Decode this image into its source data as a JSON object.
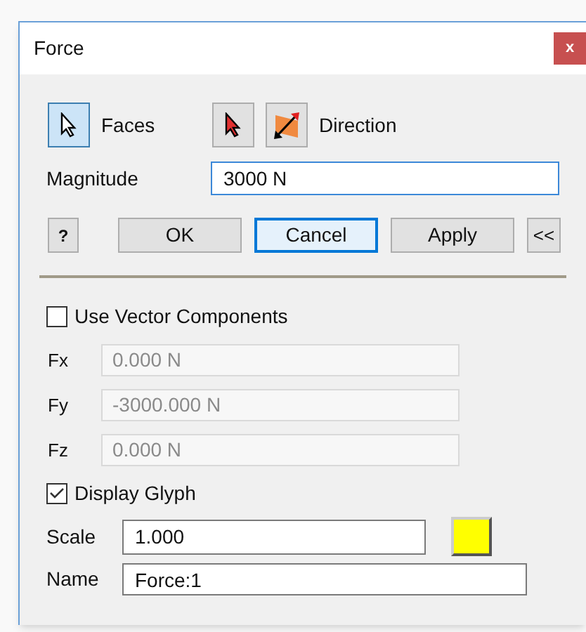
{
  "window": {
    "title": "Force",
    "close": "x"
  },
  "faces": {
    "label": "Faces",
    "selected": true
  },
  "direction": {
    "label": "Direction"
  },
  "magnitude": {
    "label": "Magnitude",
    "value": "3000 N"
  },
  "help": {
    "label": "?"
  },
  "buttons": [
    {
      "label": "OK",
      "focused": false
    },
    {
      "label": "Cancel",
      "focused": true
    },
    {
      "label": "Apply",
      "focused": false
    }
  ],
  "collapse": {
    "label": "<<"
  },
  "use_vector_components": {
    "label": "Use Vector Components",
    "checked": false
  },
  "components": [
    {
      "label": "Fx",
      "value": "0.000 N",
      "disabled": true
    },
    {
      "label": "Fy",
      "value": "-3000.000 N",
      "disabled": true
    },
    {
      "label": "Fz",
      "value": "0.000 N",
      "disabled": true
    }
  ],
  "display_glyph": {
    "label": "Display Glyph",
    "checked": true
  },
  "scale": {
    "label": "Scale",
    "value": "1.000",
    "color": "#ffff00"
  },
  "name": {
    "label": "Name",
    "value": "Force:1"
  }
}
